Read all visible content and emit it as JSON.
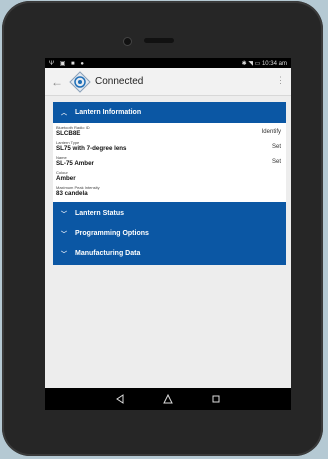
{
  "status_bar": {
    "left_icons": [
      "usb-icon",
      "image-icon",
      "lock-icon",
      "location-icon"
    ],
    "right_icons": [
      "bluetooth-icon",
      "wifi-icon",
      "battery-icon"
    ],
    "time": "10:34 am"
  },
  "app_bar": {
    "title": "Connected"
  },
  "lantern_information": {
    "header": "Lantern Information",
    "fields": [
      {
        "label": "Bluetooth Radio ID",
        "value": "SLCB8E",
        "action": "Identify"
      },
      {
        "label": "Lantern Type",
        "value": "SL75 with 7-degree lens",
        "action": "Set"
      },
      {
        "label": "Name",
        "value": "SL-75 Amber",
        "action": "Set"
      },
      {
        "label": "Colour",
        "value": "Amber",
        "action": ""
      },
      {
        "label": "Maximum Peak Intensity",
        "value": "83 candela",
        "action": ""
      }
    ]
  },
  "sections": [
    {
      "header": "Lantern Status"
    },
    {
      "header": "Programming Options"
    },
    {
      "header": "Manufacturing Data"
    }
  ],
  "colors": {
    "accent": "#0b57a4",
    "background": "#b5c9d3"
  }
}
